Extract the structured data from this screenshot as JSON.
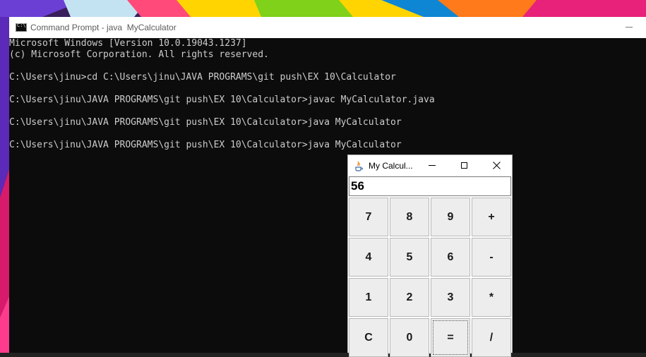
{
  "cmd": {
    "title": "Command Prompt - java  MyCalculator",
    "lines": [
      "Microsoft Windows [Version 10.0.19043.1237]",
      "(c) Microsoft Corporation. All rights reserved.",
      "",
      "C:\\Users\\jinu>cd C:\\Users\\jinu\\JAVA PROGRAMS\\git push\\EX 10\\Calculator",
      "",
      "C:\\Users\\jinu\\JAVA PROGRAMS\\git push\\EX 10\\Calculator>javac MyCalculator.java",
      "",
      "C:\\Users\\jinu\\JAVA PROGRAMS\\git push\\EX 10\\Calculator>java MyCalculator",
      "",
      "C:\\Users\\jinu\\JAVA PROGRAMS\\git push\\EX 10\\Calculator>java MyCalculator"
    ],
    "icon": "cmd-icon"
  },
  "calc": {
    "title": "My Calcul...",
    "icon": "java-icon",
    "display": "56",
    "keys": [
      "7",
      "8",
      "9",
      "+",
      "4",
      "5",
      "6",
      "-",
      "1",
      "2",
      "3",
      "*",
      "C",
      "0",
      "=",
      "/"
    ],
    "focused_key": "="
  },
  "colors": {
    "console_bg": "#0c0c0c",
    "console_text": "#cccccc",
    "key_bg": "#ededed"
  }
}
